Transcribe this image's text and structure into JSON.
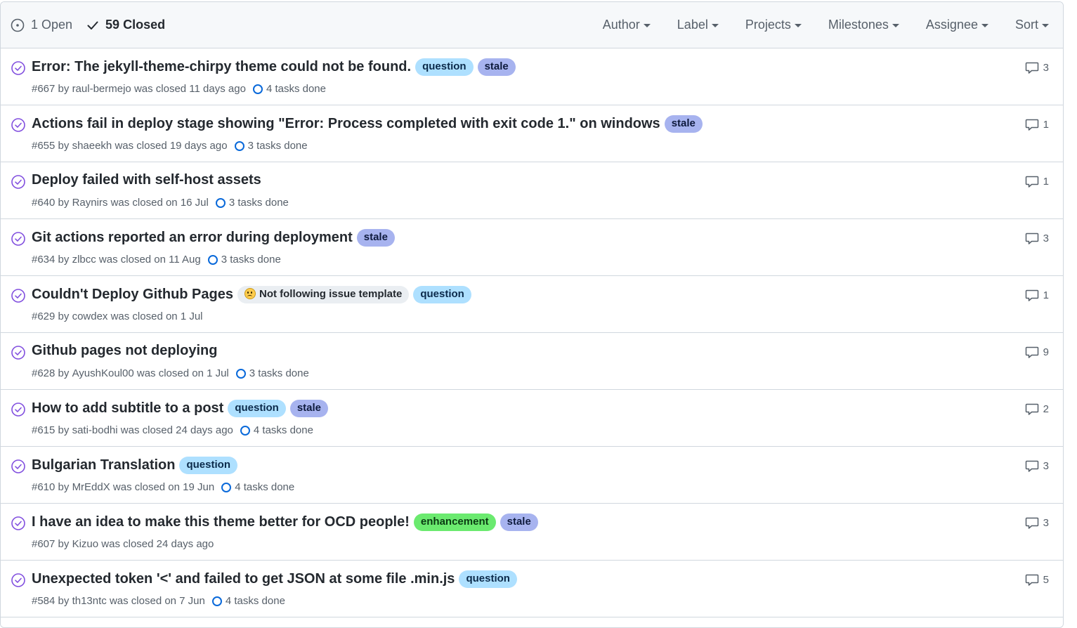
{
  "header": {
    "open_label": "1 Open",
    "closed_label": "59 Closed",
    "filters": [
      "Author",
      "Label",
      "Projects",
      "Milestones",
      "Assignee",
      "Sort"
    ]
  },
  "colors": {
    "closed_purple": "#8250df",
    "question": "#aee0ff",
    "stale": "#a7b3ef",
    "enhancement": "#6bea6f",
    "template": "#eaeef2"
  },
  "issues": [
    {
      "title": "Error: The jekyll-theme-chirpy theme could not be found.",
      "labels": [
        "question",
        "stale"
      ],
      "number": "#667",
      "by": "by",
      "author": "raul-bermejo",
      "closed": "was closed 11 days ago",
      "tasks": "4 tasks done",
      "comments": "3"
    },
    {
      "title": "Actions fail in deploy stage showing \"Error: Process completed with exit code 1.\" on windows",
      "labels": [
        "stale"
      ],
      "number": "#655",
      "by": "by",
      "author": "shaeekh",
      "closed": "was closed 19 days ago",
      "tasks": "3 tasks done",
      "comments": "1"
    },
    {
      "title": "Deploy failed with self-host assets",
      "labels": [],
      "number": "#640",
      "by": "by",
      "author": "Raynirs",
      "closed": "was closed on 16 Jul",
      "tasks": "3 tasks done",
      "comments": "1"
    },
    {
      "title": "Git actions reported an error during deployment",
      "labels": [
        "stale"
      ],
      "number": "#634",
      "by": "by",
      "author": "zlbcc",
      "closed": "was closed on 11 Aug",
      "tasks": "3 tasks done",
      "comments": "3"
    },
    {
      "title": "Couldn't Deploy Github Pages",
      "labels": [
        "Not following issue template",
        "question"
      ],
      "number": "#629",
      "by": "by",
      "author": "cowdex",
      "closed": "was closed on 1 Jul",
      "tasks": "",
      "comments": "1"
    },
    {
      "title": "Github pages not deploying",
      "labels": [],
      "number": "#628",
      "by": "by",
      "author": "AyushKoul00",
      "closed": "was closed on 1 Jul",
      "tasks": "3 tasks done",
      "comments": "9"
    },
    {
      "title": "How to add subtitle to a post",
      "labels": [
        "question",
        "stale"
      ],
      "number": "#615",
      "by": "by",
      "author": "sati-bodhi",
      "closed": "was closed 24 days ago",
      "tasks": "4 tasks done",
      "comments": "2"
    },
    {
      "title": "Bulgarian Translation",
      "labels": [
        "question"
      ],
      "number": "#610",
      "by": "by",
      "author": "MrEddX",
      "closed": "was closed on 19 Jun",
      "tasks": "4 tasks done",
      "comments": "3"
    },
    {
      "title": "I have an idea to make this theme better for OCD people!",
      "labels": [
        "enhancement",
        "stale"
      ],
      "number": "#607",
      "by": "by",
      "author": "Kizuo",
      "closed": "was closed 24 days ago",
      "tasks": "",
      "comments": "3"
    },
    {
      "title": "Unexpected token '<' and failed to get JSON at some file .min.js",
      "labels": [
        "question"
      ],
      "number": "#584",
      "by": "by",
      "author": "th13ntc",
      "closed": "was closed on 7 Jun",
      "tasks": "4 tasks done",
      "comments": "5"
    }
  ]
}
